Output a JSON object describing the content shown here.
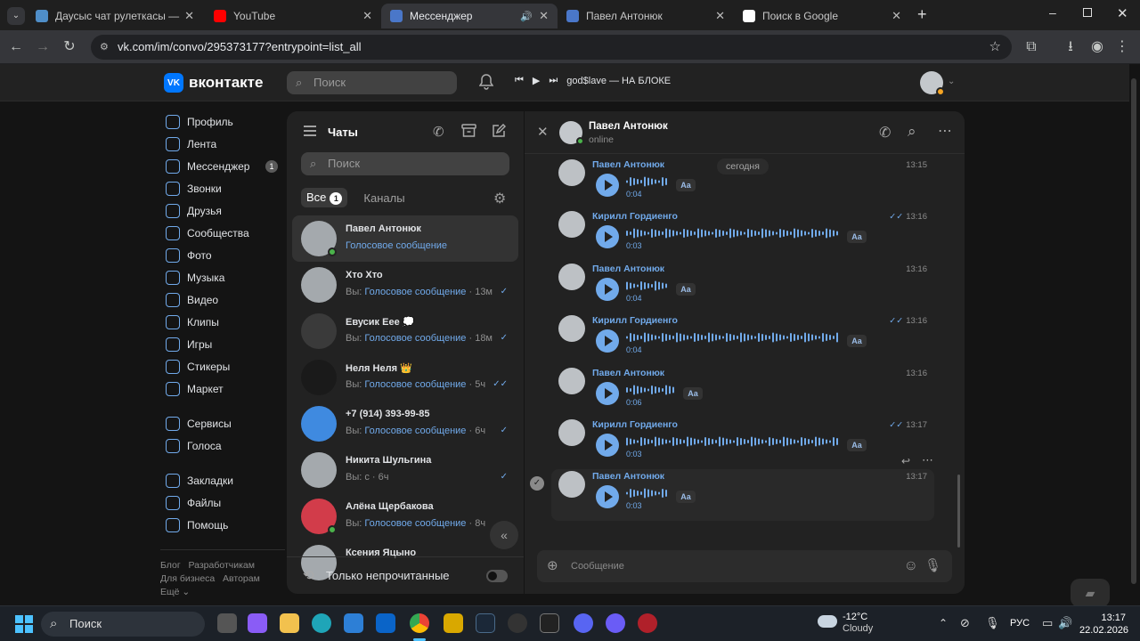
{
  "browser": {
    "tabs": [
      {
        "title": "Даусыс чат рулеткасы — Nekto",
        "color": "#4f8ec8"
      },
      {
        "title": "YouTube",
        "color": "#ff0000"
      },
      {
        "title": "Мессенджер",
        "color": "#4a77c9"
      },
      {
        "title": "Павел Антонюк",
        "color": "#4a77c9"
      },
      {
        "title": "Поиск в Google",
        "color": "#ffffff"
      }
    ],
    "url": "vk.com/im/convo/295373177?entrypoint=list_all"
  },
  "vk": {
    "logo_text": "вконтакте",
    "search_placeholder": "Поиск",
    "now_playing": "god$lave — НА БЛОКЕ"
  },
  "menu": {
    "items": [
      {
        "label": "Профиль"
      },
      {
        "label": "Лента"
      },
      {
        "label": "Мессенджер",
        "badge": "1"
      },
      {
        "label": "Звонки"
      },
      {
        "label": "Друзья"
      },
      {
        "label": "Сообщества"
      },
      {
        "label": "Фото"
      },
      {
        "label": "Музыка"
      },
      {
        "label": "Видео"
      },
      {
        "label": "Клипы"
      },
      {
        "label": "Игры"
      },
      {
        "label": "Стикеры"
      },
      {
        "label": "Маркет"
      }
    ],
    "items2": [
      {
        "label": "Сервисы"
      },
      {
        "label": "Голоса"
      }
    ],
    "items3": [
      {
        "label": "Закладки"
      },
      {
        "label": "Файлы"
      },
      {
        "label": "Помощь"
      }
    ],
    "footer": {
      "blog": "Блог",
      "dev": "Разработчикам",
      "biz": "Для бизнеса",
      "authors": "Авторам",
      "more": "Ещё ⌄"
    }
  },
  "chats": {
    "title": "Чаты",
    "search_placeholder": "Поиск",
    "tab_all": "Все",
    "tab_all_count": "1",
    "tab_channels": "Каналы",
    "unread_only": "Только непрочитанные",
    "list": [
      {
        "name": "Павел Антонюк",
        "prefix": "",
        "preview": "Голосовое сообщение",
        "time": "",
        "check": "",
        "online": true,
        "avatar": "#a4a9ad"
      },
      {
        "name": "Хто Хто",
        "prefix": "Вы: ",
        "preview": "Голосовое сообщение",
        "time": " · 13м",
        "check": "✓",
        "online": false,
        "avatar": "#a4a9ad"
      },
      {
        "name": "Евусик Еее 💭",
        "prefix": "Вы: ",
        "preview": "Голосовое сообщение",
        "time": " · 18м",
        "check": "✓",
        "online": false,
        "avatar": "#3a3a3a"
      },
      {
        "name": "Неля Неля 👑",
        "prefix": "Вы: ",
        "preview": "Голосовое сообщение",
        "time": " · 5ч",
        "check": "✓✓",
        "online": false,
        "avatar": "#1a1a1a"
      },
      {
        "name": "+7 (914) 393-99-85",
        "prefix": "Вы: ",
        "preview": "Голосовое сообщение",
        "time": " · 6ч",
        "check": "✓",
        "online": false,
        "avatar": "#3f8ae0"
      },
      {
        "name": "Никита Шульгина",
        "prefix": "Вы: с",
        "preview": "",
        "time": " · 6ч",
        "check": "✓",
        "online": false,
        "avatar": "#a4a9ad"
      },
      {
        "name": "Алёна Щербакова",
        "prefix": "Вы: ",
        "preview": "Голосовое сообщение",
        "time": " · 8ч",
        "check": "",
        "online": true,
        "avatar": "#d23c4a"
      },
      {
        "name": "Ксения Яцыно",
        "prefix": "",
        "preview": "",
        "time": "",
        "check": "",
        "online": false,
        "avatar": "#a4a9ad"
      }
    ]
  },
  "convo": {
    "name": "Павел Антонюк",
    "status": "online",
    "date_pill": "сегодня",
    "composer_placeholder": "Сообщение",
    "messages": [
      {
        "sender": "Павел Антонюк",
        "time": "13:15",
        "dur": "0:04",
        "long": false,
        "read": ""
      },
      {
        "sender": "Кирилл Гордиенго",
        "time": "13:16",
        "dur": "0:03",
        "long": true,
        "read": "✓✓"
      },
      {
        "sender": "Павел Антонюк",
        "time": "13:16",
        "dur": "0:04",
        "long": false,
        "read": ""
      },
      {
        "sender": "Кирилл Гордиенго",
        "time": "13:16",
        "dur": "0:04",
        "long": true,
        "read": "✓✓"
      },
      {
        "sender": "Павел Антонюк",
        "time": "13:16",
        "dur": "0:06",
        "long": false,
        "read": ""
      },
      {
        "sender": "Кирилл Гордиенго",
        "time": "13:17",
        "dur": "0:03",
        "long": true,
        "read": "✓✓"
      },
      {
        "sender": "Павел Антонюк",
        "time": "13:17",
        "dur": "0:03",
        "long": false,
        "read": ""
      }
    ],
    "transcribe_label": "Aa"
  },
  "taskbar": {
    "search_placeholder": "Поиск",
    "weather_temp": "-12°C",
    "weather_desc": "Cloudy",
    "lang": "РУС",
    "time": "13:17",
    "date": "22.02.2026"
  }
}
